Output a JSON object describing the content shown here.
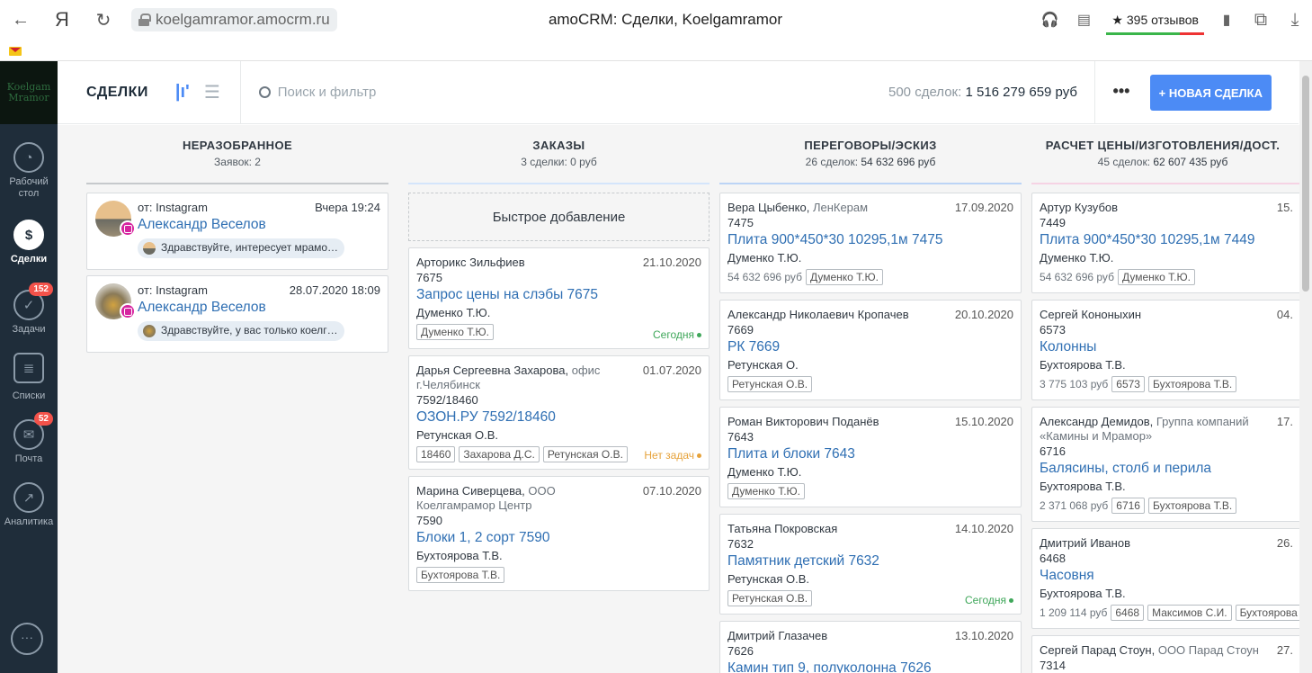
{
  "browser": {
    "url": "koelgamramor.amocrm.ru",
    "title": "amoCRM: Сделки, Koelgamramor",
    "reviews": "395 отзывов",
    "reviews_star": "★"
  },
  "sidebar": {
    "logo_text": "Koelgam Mramor",
    "items": [
      {
        "label": "Рабочий стол",
        "icon": "dashboard-icon"
      },
      {
        "label": "Сделки",
        "icon": "deals-icon"
      },
      {
        "label": "Задачи",
        "icon": "tasks-icon",
        "badge": "152"
      },
      {
        "label": "Списки",
        "icon": "lists-icon"
      },
      {
        "label": "Почта",
        "icon": "mail-icon",
        "badge": "52"
      },
      {
        "label": "Аналитика",
        "icon": "analytics-icon"
      }
    ]
  },
  "header": {
    "title": "СДЕЛКИ",
    "search_placeholder": "Поиск и фильтр",
    "totals_prefix": "500 сделок:",
    "totals_value": "1 516 279 659 руб",
    "more": "•••",
    "new_deal": "+ НОВАЯ СДЕЛКА"
  },
  "columns": [
    {
      "name": "НЕРАЗОБРАННОЕ",
      "sub_prefix": "Заявок: 2",
      "sub_value": "",
      "color": "#c6c9cc",
      "inbox": [
        {
          "source": "от: Instagram",
          "time": "Вчера 19:24",
          "name": "Александр Веселов",
          "message": "Здравствуйте, интересует мрамо…"
        },
        {
          "source": "от: Instagram",
          "time": "28.07.2020 18:09",
          "name": "Александр Веселов",
          "message": "Здравствуйте, у вас только коелг…"
        }
      ]
    },
    {
      "name": "ЗАКАЗЫ",
      "sub_prefix": "3 сделки: 0 руб",
      "sub_value": "",
      "color": "#d4e5fb",
      "quick_add": "Быстрое добавление",
      "cards": [
        {
          "contact": "Арторикс Зильфиев",
          "company": "",
          "date": "21.10.2020",
          "num": "7675",
          "title": "Запрос цены на слэбы 7675",
          "resp": "Думенко Т.Ю.",
          "budget": "",
          "tags": [
            "Думенко Т.Ю."
          ],
          "status": "Сегодня",
          "status_color": "green"
        },
        {
          "contact": "Дарья Сергеевна Захарова,",
          "company": " офис г.Челябинск",
          "date": "01.07.2020",
          "num": "7592/18460",
          "title": "ОЗОН.РУ 7592/18460",
          "resp": "Ретунская О.В.",
          "budget": "",
          "tags": [
            "18460",
            "Захарова Д.С.",
            "Ретунская О.В."
          ],
          "status": "Нет задач",
          "status_color": "orange"
        },
        {
          "contact": "Марина Сиверцева,",
          "company": " ООО Коелгамрамор Центр",
          "date": "07.10.2020",
          "num": "7590",
          "title": "Блоки 1, 2 сорт 7590",
          "resp": "Бухтоярова Т.В.",
          "budget": "",
          "tags": [
            "Бухтоярова Т.В."
          ],
          "status": "",
          "status_color": ""
        }
      ]
    },
    {
      "name": "ПЕРЕГОВОРЫ/ЭСКИЗ",
      "sub_prefix": "26 сделок:",
      "sub_value": "54 632 696 руб",
      "color": "#bcd4f6",
      "cards": [
        {
          "contact": "Вера Цыбенко,",
          "company": " ЛенКерам",
          "date": "17.09.2020",
          "num": "7475",
          "title": "Плита 900*450*30 10295,1м 7475",
          "resp": "Думенко Т.Ю.",
          "budget": "54 632 696 руб",
          "tags": [
            "Думенко Т.Ю."
          ],
          "status": "",
          "status_color": ""
        },
        {
          "contact": "Александр Николаевич Кропачев",
          "company": "",
          "date": "20.10.2020",
          "num": "7669",
          "title": "РК 7669",
          "resp": "Ретунская О.",
          "budget": "",
          "tags": [
            "Ретунская О.В."
          ],
          "status": "",
          "status_color": ""
        },
        {
          "contact": "Роман Викторович Поданёв",
          "company": "",
          "date": "15.10.2020",
          "num": "7643",
          "title": "Плита и блоки 7643",
          "resp": "Думенко Т.Ю.",
          "budget": "",
          "tags": [
            "Думенко Т.Ю."
          ],
          "status": "",
          "status_color": ""
        },
        {
          "contact": "Татьяна Покровская",
          "company": "",
          "date": "14.10.2020",
          "num": "7632",
          "title": "Памятник детский 7632",
          "resp": "Ретунская О.В.",
          "budget": "",
          "tags": [
            "Ретунская О.В."
          ],
          "status": "Сегодня",
          "status_color": "green"
        },
        {
          "contact": "Дмитрий Глазачев",
          "company": "",
          "date": "13.10.2020",
          "num": "7626",
          "title": "Камин тип 9, полуколонна 7626",
          "resp": "",
          "budget": "",
          "tags": [],
          "status": "",
          "status_color": ""
        }
      ]
    },
    {
      "name": "РАСЧЕТ ЦЕНЫ/ИЗГОТОВЛЕНИЯ/ДОСТ.",
      "sub_prefix": "45 сделок:",
      "sub_value": "62 607 435 руб",
      "color": "#f6d3e4",
      "cards": [
        {
          "contact": "Артур Кузубов",
          "company": "",
          "date": "15.",
          "num": "7449",
          "title": "Плита 900*450*30 10295,1м 7449",
          "resp": "Думенко Т.Ю.",
          "budget": "54 632 696 руб",
          "tags": [
            "Думенко Т.Ю."
          ],
          "status": "",
          "status_color": ""
        },
        {
          "contact": "Сергей Кононыхин",
          "company": "",
          "date": "04.",
          "num": "6573",
          "title": "Колонны",
          "resp": "Бухтоярова Т.В.",
          "budget": "3 775 103 руб",
          "tags": [
            "6573",
            "Бухтоярова Т.В."
          ],
          "status": "",
          "status_color": ""
        },
        {
          "contact": "Александр Демидов,",
          "company": " Группа компаний «Камины и Мрамор»",
          "date": "17.",
          "num": "6716",
          "title": "Балясины, столб и перила",
          "resp": "Бухтоярова Т.В.",
          "budget": "2 371 068 руб",
          "tags": [
            "6716",
            "Бухтоярова Т.В."
          ],
          "status": "",
          "status_color": ""
        },
        {
          "contact": "Дмитрий Иванов",
          "company": "",
          "date": "26.",
          "num": "6468",
          "title": "Часовня",
          "resp": "Бухтоярова Т.В.",
          "budget": "1 209 114 руб",
          "tags": [
            "6468",
            "Максимов С.И.",
            "Бухтоярова"
          ],
          "status": "",
          "status_color": ""
        },
        {
          "contact": "Сергей Парад Стоун,",
          "company": " ООО Парад Стоун",
          "date": "27.",
          "num": "7314",
          "title": "",
          "resp": "",
          "budget": "",
          "tags": [],
          "status": "",
          "status_color": ""
        }
      ]
    }
  ],
  "colors": {
    "accent": "#4c8bf5",
    "link": "#2f6fb3",
    "sidebar": "#1f2d3a",
    "green": "#3fa75a",
    "orange": "#e6a23a"
  }
}
